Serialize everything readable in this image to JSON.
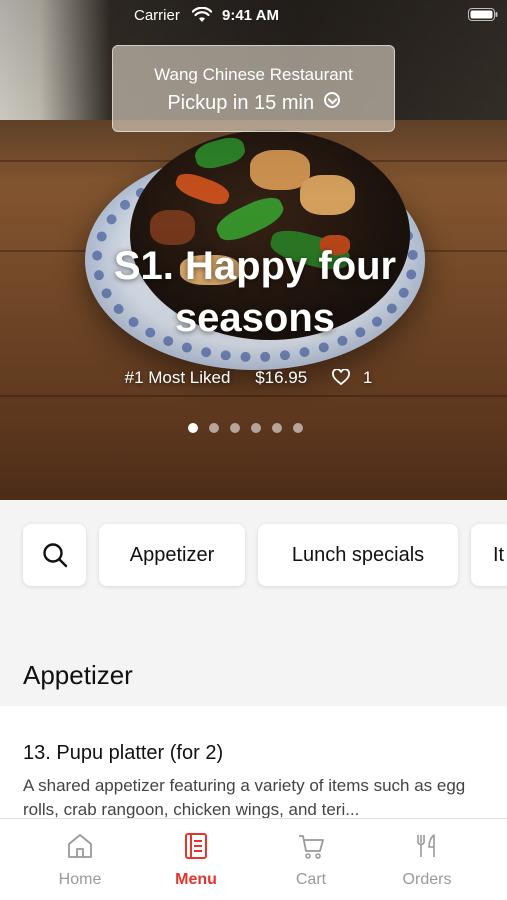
{
  "status_bar": {
    "carrier": "Carrier",
    "time": "9:41 AM"
  },
  "pickup": {
    "restaurant": "Wang Chinese Restaurant",
    "eta": "Pickup in 15 min"
  },
  "featured": {
    "title": "S1. Happy four seasons",
    "rank": "#1 Most Liked",
    "price": "$16.95",
    "likes": "1",
    "carousel": {
      "count": 6,
      "active_index": 0
    }
  },
  "categories": [
    {
      "label": "Appetizer"
    },
    {
      "label": "Lunch specials"
    },
    {
      "label": "It"
    }
  ],
  "section": {
    "title": "Appetizer"
  },
  "items": [
    {
      "name": "13. Pupu platter (for 2)",
      "description": "A shared appetizer featuring a variety of items such as egg rolls, crab rangoon, chicken wings, and teri..."
    }
  ],
  "tabs": [
    {
      "label": "Home",
      "icon": "home-icon"
    },
    {
      "label": "Menu",
      "icon": "menu-icon",
      "active": true
    },
    {
      "label": "Cart",
      "icon": "cart-icon"
    },
    {
      "label": "Orders",
      "icon": "orders-icon"
    }
  ],
  "colors": {
    "accent": "#e8332a",
    "inactive": "#9a9a9a"
  }
}
